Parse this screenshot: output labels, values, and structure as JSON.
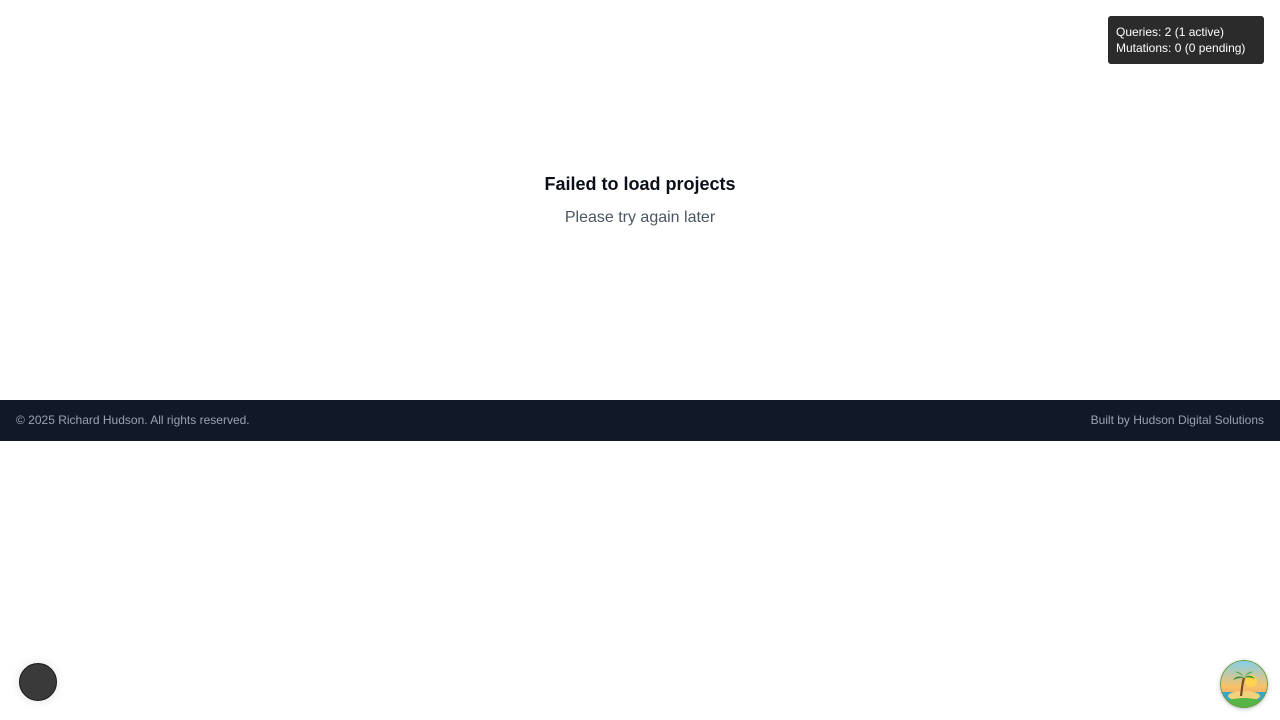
{
  "main": {
    "error_title": "Failed to load projects",
    "error_subtitle": "Please try again later"
  },
  "devtools": {
    "queries_line": "Queries: 2 (1 active)",
    "mutations_line": "Mutations: 0 (0 pending)"
  },
  "footer": {
    "copyright": "© 2025 Richard Hudson. All rights reserved.",
    "credit": "Built by Hudson Digital Solutions"
  },
  "icons": {
    "devtools_toggle": "devtools-toggle-icon",
    "logo": "palm-island-logo-icon"
  },
  "colors": {
    "footer_bg": "#111827",
    "footer_text": "#9ca3af",
    "panel_bg": "#2b2b2b"
  }
}
